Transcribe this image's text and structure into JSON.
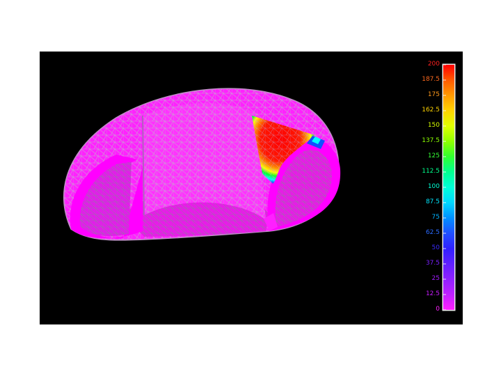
{
  "legend": {
    "labels": [
      "200",
      "187.5",
      "175",
      "162.5",
      "150",
      "137.5",
      "125",
      "112.5",
      "100",
      "87.5",
      "75",
      "62.5",
      "50",
      "37.5",
      "25",
      "12.5",
      "0"
    ],
    "label_colors": [
      "#ff2020",
      "#ff6a1e",
      "#ff9a1c",
      "#ffd400",
      "#d6ff00",
      "#8cff00",
      "#35ff35",
      "#00ff8c",
      "#00ffd4",
      "#00e8ff",
      "#00b4ff",
      "#2a6aff",
      "#3a2aff",
      "#7a20ff",
      "#a01cff",
      "#c81cff",
      "#ff20ff"
    ],
    "gradient": [
      "#ff0000",
      "#ff5a00",
      "#ff9a00",
      "#ffd400",
      "#e0ff00",
      "#90ff00",
      "#30ff30",
      "#00ff90",
      "#00ffd8",
      "#00d8ff",
      "#0090ff",
      "#2050ff",
      "#3020ff",
      "#6020ff",
      "#9020ff",
      "#c020ff",
      "#ff20ff"
    ]
  },
  "model": {
    "base_color": "#ff22ff",
    "mesh_line_color": "#b088c0",
    "hotspot_colors": [
      "#ff0000",
      "#ff8800",
      "#ffff00",
      "#00ff00",
      "#00ffff",
      "#0044ff",
      "#8800ff"
    ]
  }
}
